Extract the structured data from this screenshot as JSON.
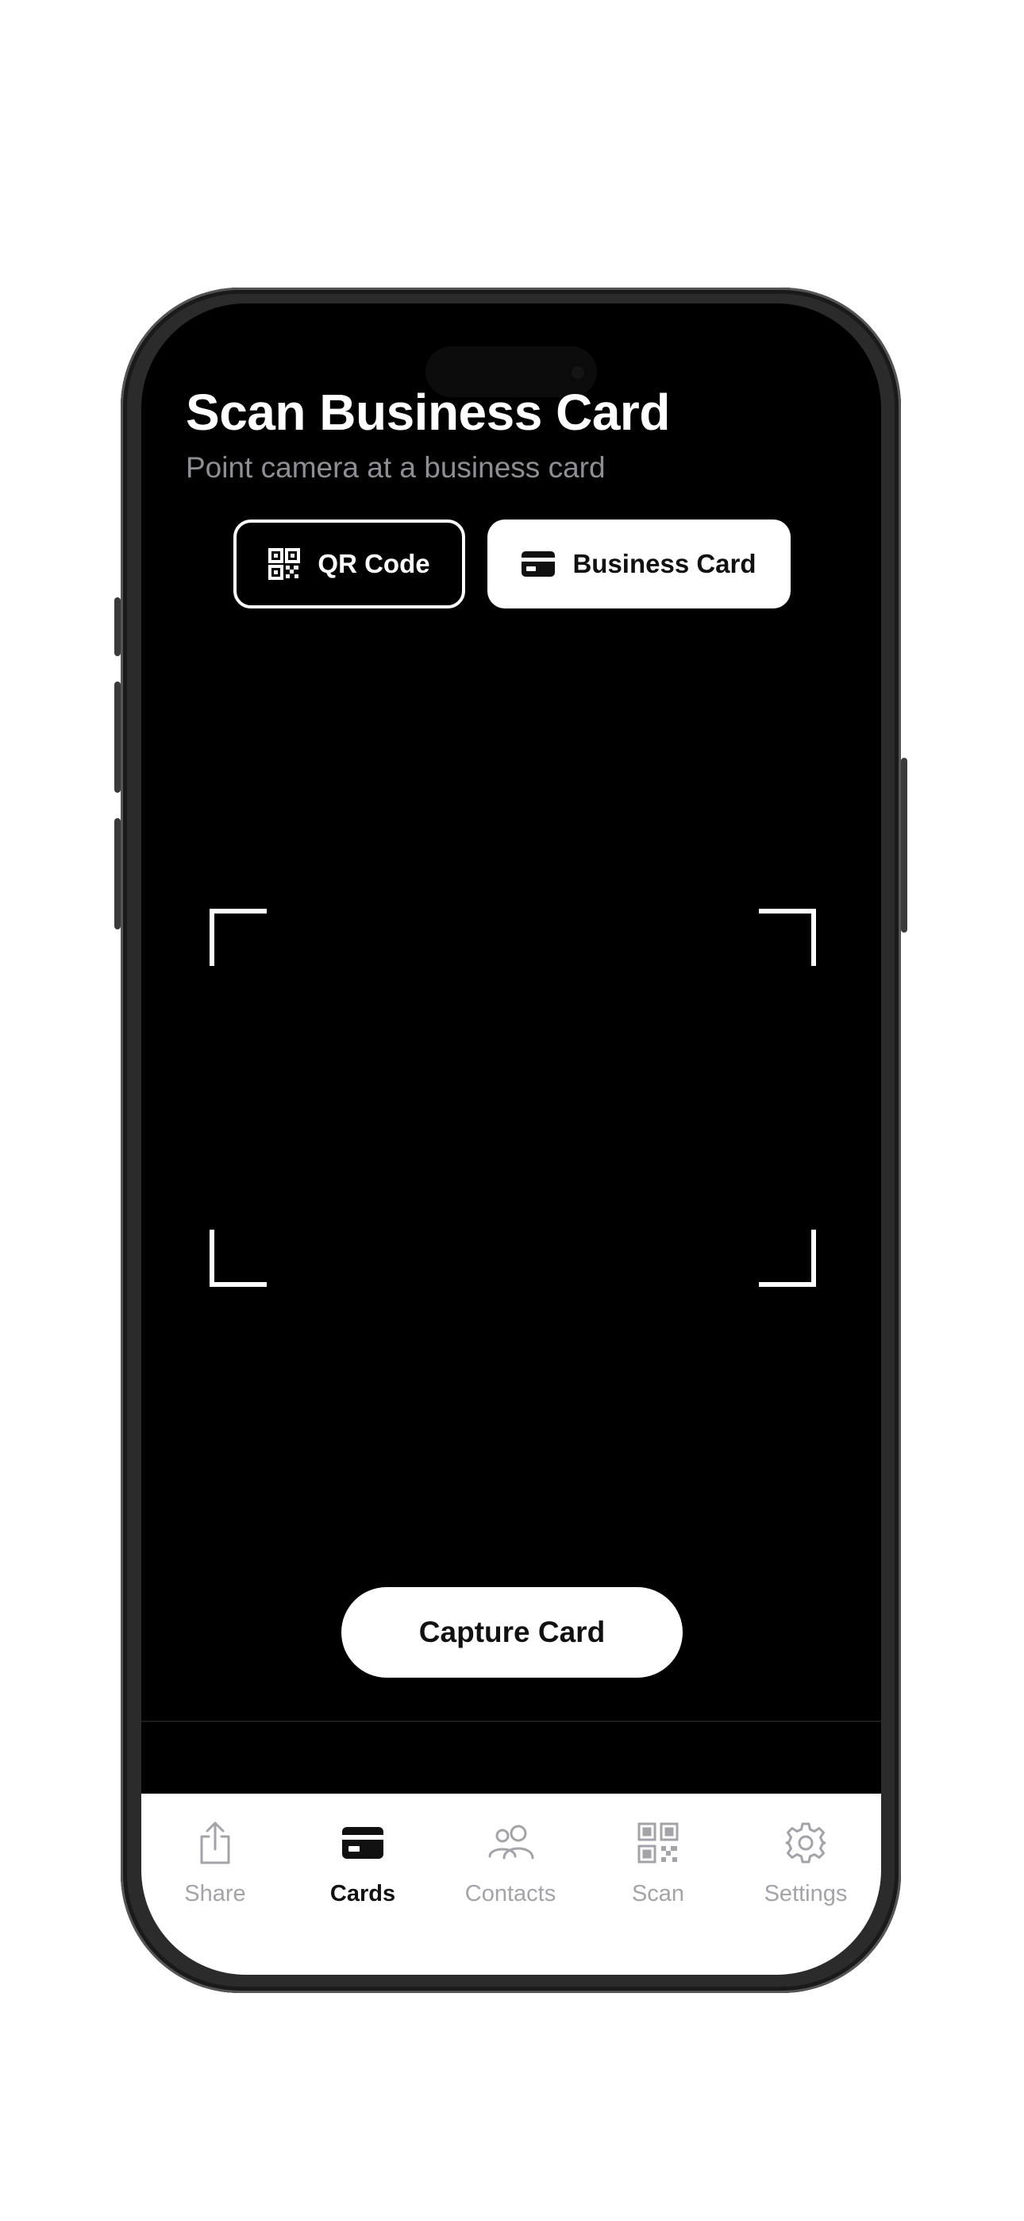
{
  "header": {
    "title": "Scan Business Card",
    "subtitle": "Point camera at a business card"
  },
  "modes": {
    "qr_label": "QR Code",
    "card_label": "Business Card",
    "selected": "Business Card"
  },
  "capture": {
    "label": "Capture Card"
  },
  "tabs": [
    {
      "label": "Share",
      "icon": "share-icon",
      "active": false
    },
    {
      "label": "Cards",
      "icon": "card-icon",
      "active": true
    },
    {
      "label": "Contacts",
      "icon": "contacts-icon",
      "active": false
    },
    {
      "label": "Scan",
      "icon": "qr-icon",
      "active": false
    },
    {
      "label": "Settings",
      "icon": "gear-icon",
      "active": false
    }
  ],
  "colors": {
    "background": "#000000",
    "foreground": "#ffffff",
    "subtitle": "#8e8e93",
    "tab_inactive": "#a3a3a8",
    "tab_active": "#111111"
  }
}
